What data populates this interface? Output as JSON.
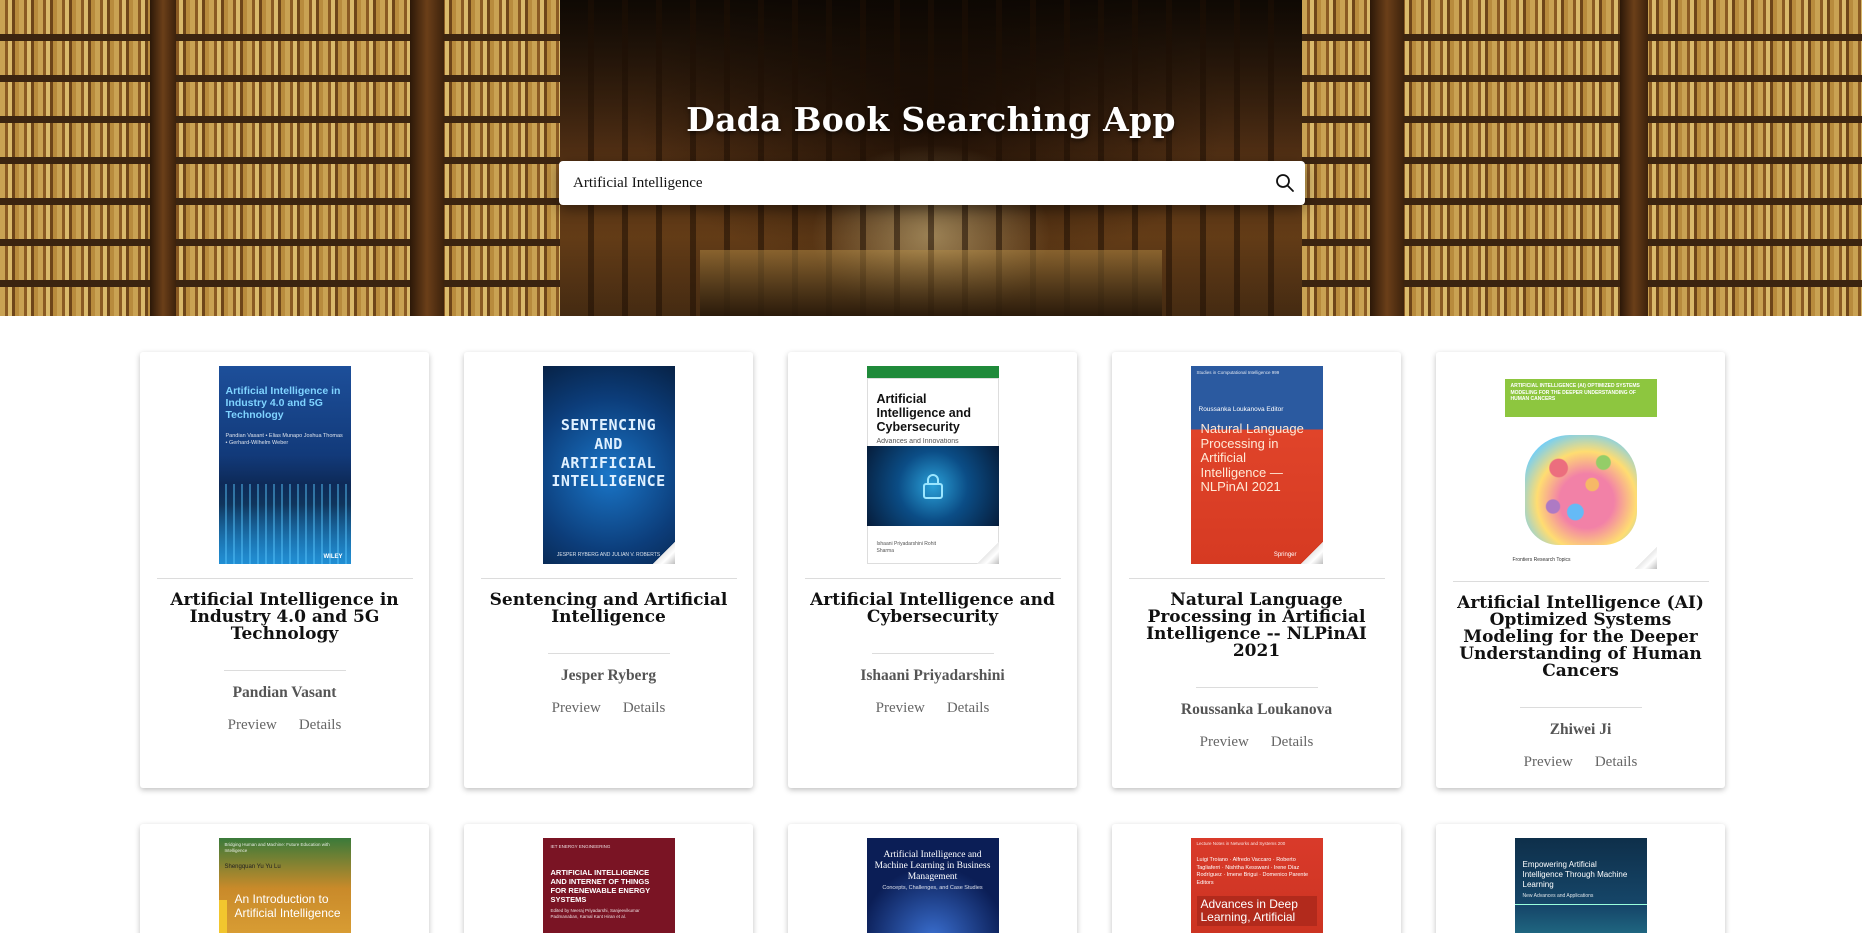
{
  "app": {
    "title": "Dada Book Searching App"
  },
  "search": {
    "value": "Artificial Intelligence"
  },
  "cards_row1": [
    {
      "title": "Artificial Intelligence in Industry 4.0 and 5G Technology",
      "author": "Pandian Vasant",
      "preview_label": "Preview",
      "details_label": "Details",
      "cover": {
        "bg": "#123a7a",
        "accent": "#2aa7e6",
        "title": "Artificial Intelligence in Industry 4.0 and 5G Technology",
        "sub": "Pandian Vasant • Elias Munapo Joshua Thomas • Gerhard-Wilhelm Weber",
        "brand": "WILEY"
      }
    },
    {
      "title": "Sentencing and Artificial Intelligence",
      "author": "Jesper Ryberg",
      "preview_label": "Preview",
      "details_label": "Details",
      "cover": {
        "bg": "#0c3d7a",
        "accent": "#1a6fc0",
        "title": "SENTENCING AND ARTIFICIAL INTELLIGENCE",
        "sub": "JESPER RYBERG AND JULIAN V. ROBERTS"
      }
    },
    {
      "title": "Artificial Intelligence and Cybersecurity",
      "author": "Ishaani Priyadarshini",
      "preview_label": "Preview",
      "details_label": "Details",
      "cover": {
        "bg": "#ffffff",
        "accent": "#1f8a3a",
        "title": "Artificial Intelligence and Cybersecurity",
        "sub": "Advances and Innovations",
        "editors": "Ishaani Priyadarshini Rohit Sharma"
      }
    },
    {
      "title": "Natural Language Processing in Artificial Intelligence -- NLPinAI 2021",
      "author": "Roussanka Loukanova",
      "preview_label": "Preview",
      "details_label": "Details",
      "cover": {
        "bg": "#e0442a",
        "accent": "#2b5aa0",
        "series": "Studies in Computational Intelligence 999",
        "editor": "Roussanka Loukanova Editor",
        "title": "Natural Language Processing in Artificial Intelligence — NLPinAI 2021",
        "brand": "Springer"
      }
    },
    {
      "title": "Artificial Intelligence (AI) Optimized Systems Modeling for the Deeper Understanding of Human Cancers",
      "author": "Zhiwei Ji",
      "preview_label": "Preview",
      "details_label": "Details",
      "cover": {
        "bg": "#ffffff",
        "accent": "#8dc63f",
        "title": "ARTIFICIAL INTELLIGENCE (AI) OPTIMIZED SYSTEMS MODELING FOR THE DEEPER UNDERSTANDING OF HUMAN CANCERS",
        "brand": "Frontiers Research Topics"
      }
    }
  ],
  "cards_row2": [
    {
      "cover": {
        "bg": "#c98a2a",
        "accent": "#3a7a3a",
        "series": "Bridging Human and Machine: Future Education with Intelligence",
        "author": "Shengquan Yu Yu Lu",
        "title": "An Introduction to Artificial Intelligence"
      }
    },
    {
      "cover": {
        "bg": "#7a1424",
        "accent": "#7a1424",
        "series": "IET ENERGY ENGINEERING",
        "title": "ARTIFICIAL INTELLIGENCE AND INTERNET OF THINGS FOR RENEWABLE ENERGY SYSTEMS",
        "sub": "Edited by Neeraj Priyadarshi, Sanjeevikumar Padmanaban, Kamal Kant Hiran et al."
      }
    },
    {
      "cover": {
        "bg": "#0b1e56",
        "accent": "#5a8ad0",
        "title": "Artificial Intelligence and Machine Learning in Business Management",
        "sub": "Concepts, Challenges, and Case Studies"
      }
    },
    {
      "cover": {
        "bg": "#d93a2a",
        "accent": "#b22a1c",
        "series": "Lecture Notes in Networks and Systems 200",
        "editors": "Luigi Troiano · Alfredo Vaccaro · Roberto Tagliaferri · Nishtha Kesswani · Irene Díaz Rodríguez · Imene Brigui · Domenico Parente  Editors",
        "title": "Advances in Deep Learning, Artificial"
      }
    },
    {
      "cover": {
        "bg": "#0e2f4a",
        "accent": "#2a8a9a",
        "title": "Empowering Artificial Intelligence Through Machine Learning",
        "sub": "New Advances and Applications"
      }
    }
  ]
}
